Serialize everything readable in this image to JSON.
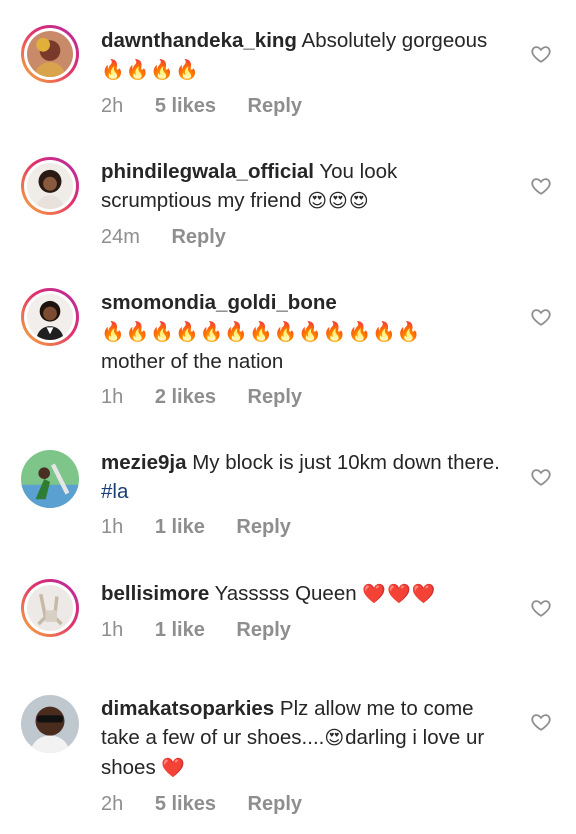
{
  "comments": [
    {
      "username": "dawnthandeka_king",
      "text": "Absolutely gorgeous ",
      "emoji": "🔥🔥🔥🔥",
      "time": "2h",
      "likes": "5 likes",
      "reply": "Reply"
    },
    {
      "username": "phindilegwala_official",
      "text": "You look scrumptious my friend ",
      "emoji": "😍😍😍",
      "time": "24m",
      "reply": "Reply"
    },
    {
      "username": "smomondia_goldi_bone",
      "emoji": "🔥🔥🔥🔥🔥🔥🔥🔥🔥🔥🔥🔥🔥",
      "text": "mother of the nation",
      "time": "1h",
      "likes": "2 likes",
      "reply": "Reply"
    },
    {
      "username": "mezie9ja",
      "text": "My block is just 10km down there. ",
      "hashtag": "#la",
      "time": "1h",
      "likes": "1 like",
      "reply": "Reply"
    },
    {
      "username": "bellisimore",
      "text": "Yasssss Queen ",
      "emoji": "❤️❤️❤️",
      "time": "1h",
      "likes": "1 like",
      "reply": "Reply"
    },
    {
      "username": "dimakatsoparkies",
      "text_a": "Plz allow me to come take a few of ur shoes....",
      "emoji_a": "😍",
      "text_b": "darling i love ur shoes ",
      "emoji_b": "❤️",
      "time": "2h",
      "likes": "5 likes",
      "reply": "Reply"
    }
  ],
  "icons": {
    "like": "heart-outline-icon"
  },
  "colors": {
    "username": "#262626",
    "meta": "#8e8e8e",
    "hashtag": "#1a3f72",
    "story_ring": "#e1306c"
  }
}
